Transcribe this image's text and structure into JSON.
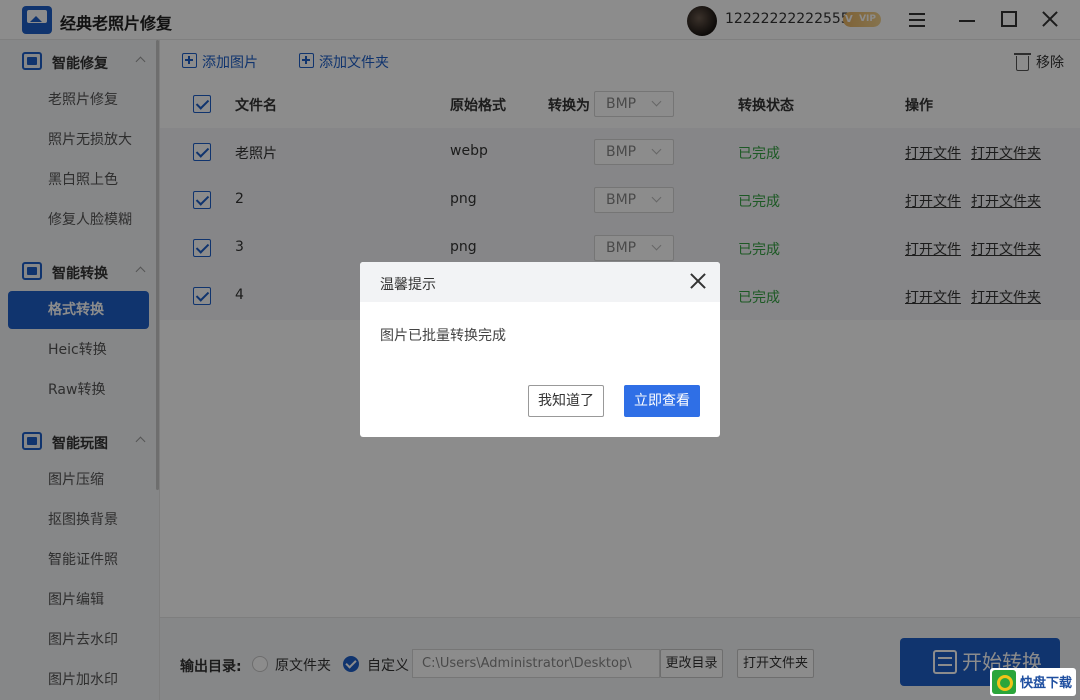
{
  "titlebar": {
    "app_title": "经典老照片修复",
    "phone": "12222222222555",
    "vip": "VIP"
  },
  "sidebar": {
    "groups": [
      {
        "label": "智能修复",
        "icon": "image-repair-icon"
      },
      {
        "label": "智能转换",
        "icon": "convert-icon"
      },
      {
        "label": "智能玩图",
        "icon": "image-play-icon"
      }
    ],
    "items": [
      {
        "label": "老照片修复"
      },
      {
        "label": "照片无损放大"
      },
      {
        "label": "黑白照上色"
      },
      {
        "label": "修复人脸模糊"
      },
      {
        "label": "格式转换",
        "active": true
      },
      {
        "label": "Heic转换"
      },
      {
        "label": "Raw转换"
      },
      {
        "label": "图片压缩"
      },
      {
        "label": "抠图换背景"
      },
      {
        "label": "智能证件照"
      },
      {
        "label": "图片编辑"
      },
      {
        "label": "图片去水印"
      },
      {
        "label": "图片加水印"
      }
    ]
  },
  "toolbar": {
    "add_image": "添加图片",
    "add_folder": "添加文件夹",
    "remove": "移除"
  },
  "table": {
    "headers": {
      "name": "文件名",
      "original": "原始格式",
      "convert_to": "转换为",
      "format": "BMP",
      "state": "转换状态",
      "ops": "操作"
    },
    "rows": [
      {
        "name": "老照片",
        "original": "webp",
        "format": "BMP",
        "state": "已完成",
        "open_file": "打开文件",
        "open_folder": "打开文件夹"
      },
      {
        "name": "2",
        "original": "png",
        "format": "BMP",
        "state": "已完成",
        "open_file": "打开文件",
        "open_folder": "打开文件夹"
      },
      {
        "name": "3",
        "original": "png",
        "format": "BMP",
        "state": "已完成",
        "open_file": "打开文件",
        "open_folder": "打开文件夹"
      },
      {
        "name": "4",
        "original": "",
        "format": "",
        "state": "已完成",
        "open_file": "打开文件",
        "open_folder": "打开文件夹"
      }
    ]
  },
  "bottom": {
    "output_label": "输出目录:",
    "option_original": "原文件夹",
    "option_custom": "自定义",
    "path": "C:\\Users\\Administrator\\Desktop\\",
    "change_dir": "更改目录",
    "open_folder": "打开文件夹",
    "start": "开始转换"
  },
  "dialog": {
    "title": "温馨提示",
    "message": "图片已批量转换完成",
    "ok": "我知道了",
    "view": "立即查看"
  },
  "watermark": {
    "text": "快盘下载"
  },
  "colors": {
    "accent": "#1e5fc8",
    "success": "#35a244",
    "dialog_primary": "#2f6fe6"
  }
}
